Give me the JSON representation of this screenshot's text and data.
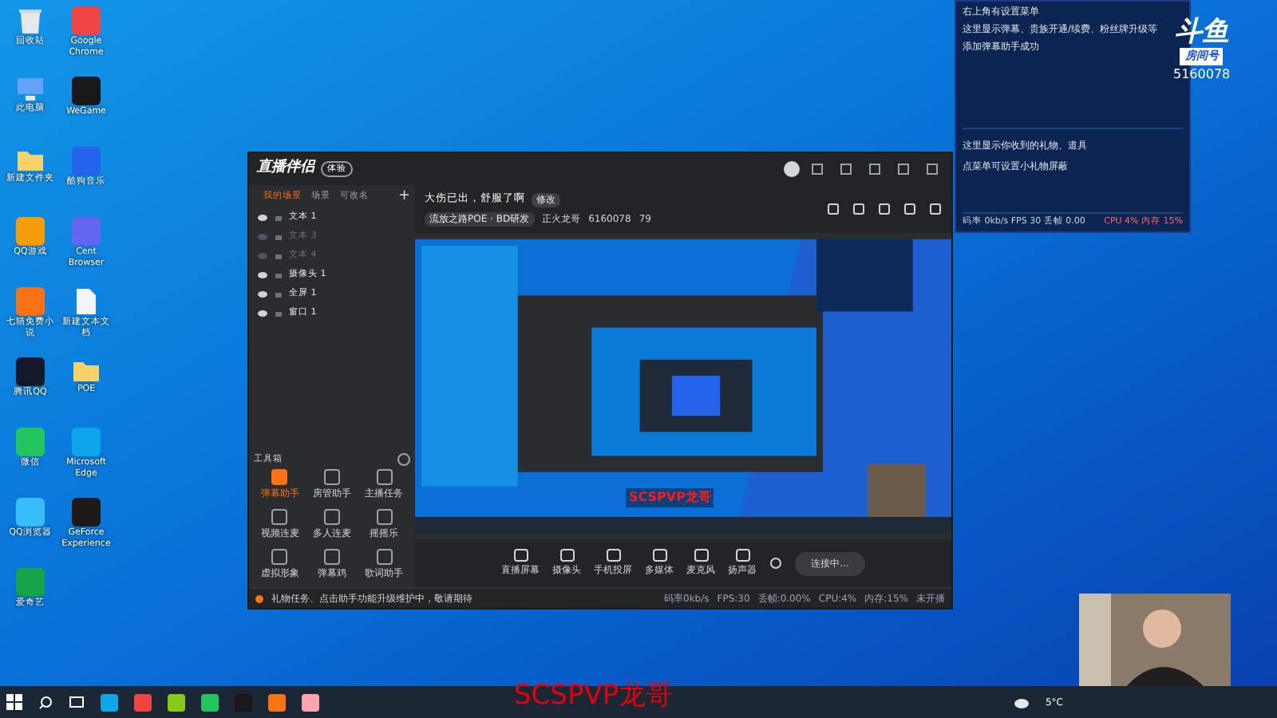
{
  "desktop_icons": [
    {
      "label": "回收站",
      "kind": "bin"
    },
    {
      "label": "此电脑",
      "kind": "pc"
    },
    {
      "label": "新建文件夹",
      "kind": "folder"
    },
    {
      "label": "QQ游戏",
      "kind": "app",
      "color": "#f59e0b"
    },
    {
      "label": "七猫免费小说",
      "kind": "app",
      "color": "#f97316"
    },
    {
      "label": "腾讯QQ",
      "kind": "app",
      "color": "#111827"
    },
    {
      "label": "微信",
      "kind": "app",
      "color": "#22c55e"
    },
    {
      "label": "QQ浏览器",
      "kind": "app",
      "color": "#38bdf8"
    },
    {
      "label": "爱奇艺",
      "kind": "app",
      "color": "#16a34a"
    },
    {
      "label": "Google Chrome",
      "kind": "app",
      "color": "#ef4444"
    },
    {
      "label": "WeGame",
      "kind": "app",
      "color": "#18181b"
    },
    {
      "label": "酷狗音乐",
      "kind": "app",
      "color": "#2563eb"
    },
    {
      "label": "Cent Browser",
      "kind": "app",
      "color": "#6366f1"
    },
    {
      "label": "新建文本文档",
      "kind": "file"
    },
    {
      "label": "POE",
      "kind": "folder"
    },
    {
      "label": "Microsoft Edge",
      "kind": "app",
      "color": "#0ea5e9"
    },
    {
      "label": "GeForce Experience",
      "kind": "app",
      "color": "#1c1917"
    }
  ],
  "app": {
    "logo": "直播伴侣",
    "badge": "体验",
    "scene_tabs": [
      {
        "label": "我的场景",
        "selected": true
      },
      {
        "label": "场景",
        "selected": false
      },
      {
        "label": "可改名",
        "selected": false
      }
    ],
    "add": "+",
    "sources": [
      {
        "label": "文本 1",
        "visible": true
      },
      {
        "label": "文本 3",
        "visible": false
      },
      {
        "label": "文本 4",
        "visible": false
      },
      {
        "label": "摄像头 1",
        "visible": true
      },
      {
        "label": "全屏 1",
        "visible": true
      },
      {
        "label": "窗口 1",
        "visible": true
      }
    ],
    "toolbox_title": "工具箱",
    "tools": [
      {
        "label": "弹幕助手",
        "selected": true
      },
      {
        "label": "房管助手",
        "selected": false
      },
      {
        "label": "主播任务",
        "selected": false
      },
      {
        "label": "视频连麦",
        "selected": false
      },
      {
        "label": "多人连麦",
        "selected": false
      },
      {
        "label": "摇摇乐",
        "selected": false
      },
      {
        "label": "虚拟形象",
        "selected": false
      },
      {
        "label": "弹幕鸡",
        "selected": false
      },
      {
        "label": "歌词助手",
        "selected": false
      }
    ],
    "stream_title": "大伤已出，舒服了啊",
    "edit": "修改",
    "category": "流放之路POE · BD研发",
    "streamer": "正火龙哥",
    "room": "6160078",
    "viewers": "79",
    "overlay_text": "SCSPVP龙哥",
    "controls": [
      "直播屏幕",
      "摄像头",
      "手机投屏",
      "多媒体",
      "麦克风",
      "扬声器"
    ],
    "start_button": "连接中...",
    "notice": "礼物任务、点击助手功能升级维护中，敬请期待",
    "stats": [
      "码率0kb/s",
      "FPS:30",
      "丢帧:0.00%",
      "CPU:4%",
      "内存:15%",
      "未开播"
    ]
  },
  "chat_panel": {
    "messages": [
      "右上角有设置菜单",
      "这里显示弹幕、贵族开通/续费、粉丝牌升级等",
      "添加弹幕助手成功"
    ],
    "gift_messages": [
      "这里显示你收到的礼物、道具",
      "点菜单可设置小礼物屏蔽"
    ],
    "footer_left": "码率 0kb/s FPS 30 丢帧 0.00",
    "footer_right": "CPU 4% 内存 15%"
  },
  "room_badge": {
    "logo": "斗鱼",
    "label": "房间号",
    "number": "5160078"
  },
  "overlay_text": "SCSPVP龙哥",
  "taskbar": {
    "weather": "5°C"
  }
}
